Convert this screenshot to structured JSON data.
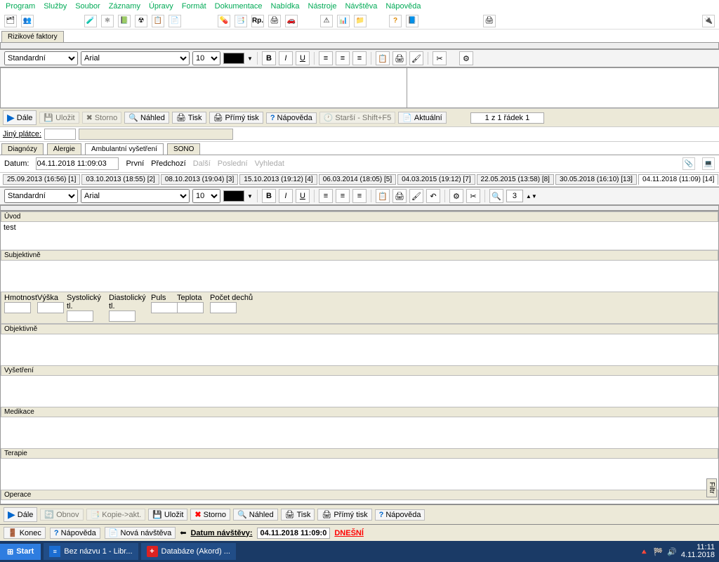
{
  "menu": [
    "Program",
    "Služby",
    "Soubor",
    "Záznamy",
    "Úpravy",
    "Formát",
    "Dokumentace",
    "Nabídka",
    "Nástroje",
    "Návštěva",
    "Nápověda"
  ],
  "risk_tab": "Rizikové faktory",
  "fmt": {
    "style": "Standardní",
    "font": "Arial",
    "size_top": "10",
    "size_main": "10"
  },
  "actions_top": {
    "dale": "Dále",
    "ulozit": "Uložit",
    "storno": "Storno",
    "nahled": "Náhled",
    "tisk": "Tisk",
    "primy_tisk": "Přímý tisk",
    "napoveda": "Nápověda",
    "starsi": "Starší - Shift+F5",
    "aktualni": "Aktuální",
    "pager": "1 z 1  řádek 1"
  },
  "jiny_platce": "Jiný plátce:",
  "mid_tabs": [
    "Diagnózy",
    "Alergie",
    "Ambulantní vyšetření",
    "SONO"
  ],
  "date_row": {
    "label": "Datum:",
    "value": "04.11.2018 11:09:03",
    "prvni": "První",
    "predchozi": "Předchozí",
    "dalsi": "Další",
    "posledni": "Poslední",
    "vyhledat": "Vyhledat"
  },
  "history": [
    "25.09.2013 (16:56) [1]",
    "03.10.2013 (18:55) [2]",
    "08.10.2013 (19:04) [3]",
    "15.10.2013 (19:12) [4]",
    "06.03.2014 (18:05) [5]",
    "04.03.2015 (19:12) [7]",
    "22.05.2015 (13:58) [8]",
    "30.05.2018 (16:10) [13]",
    "04.11.2018 (11:09) [14]"
  ],
  "sections": {
    "uvod": "Úvod",
    "uvod_text": "test",
    "subj": "Subjektivně",
    "obj": "Objektivně",
    "vys": "Vyšetření",
    "med": "Medikace",
    "ter": "Terapie",
    "ope": "Operace"
  },
  "vitals": [
    "Hmotnost",
    "Výška",
    "Systolický tl.",
    "Diastolický tl.",
    "Puls",
    "Teplota",
    "Počet dechů"
  ],
  "size_input": "3",
  "bottom": {
    "dale": "Dále",
    "obnov": "Obnov",
    "kopie": "Kopie->akt.",
    "ulozit": "Uložit",
    "storno": "Storno",
    "nahled": "Náhled",
    "tisk": "Tisk",
    "primy_tisk": "Přímý tisk",
    "napoveda": "Nápověda"
  },
  "status": {
    "konec": "Konec",
    "napoveda": "Nápověda",
    "nova": "Nová návštěva",
    "datum_label": "Datum návštěvy:",
    "datum_val": "04.11.2018 11:09:0",
    "dnesni": "DNEŠNÍ"
  },
  "taskbar": {
    "start": "Start",
    "t1": "Bez názvu 1 - Libr...",
    "t2": "Databáze (Akord) ...",
    "time": "11:11",
    "date": "4.11.2018"
  }
}
